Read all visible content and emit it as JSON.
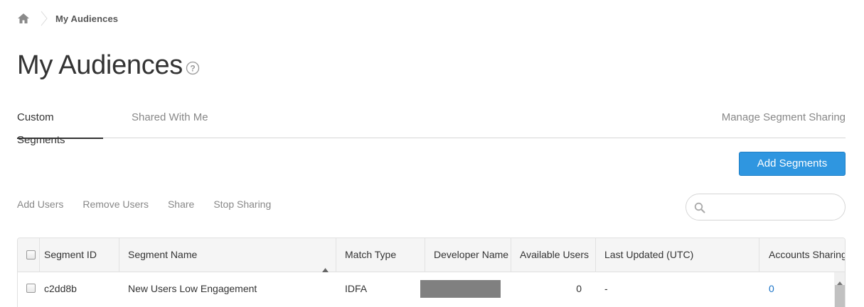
{
  "breadcrumb": {
    "home_icon": "home-icon",
    "current": "My Audiences"
  },
  "page": {
    "title": "My Audiences",
    "help_icon": "help-circle-icon"
  },
  "tabs": [
    {
      "label": "Custom Segments",
      "active": true
    },
    {
      "label": "Shared With Me",
      "active": false
    }
  ],
  "manage_link": "Manage Segment Sharing",
  "add_button": {
    "label": "Add Segments",
    "color": "#2f96e0"
  },
  "actions": [
    "Add Users",
    "Remove Users",
    "Share",
    "Stop Sharing"
  ],
  "search": {
    "placeholder": "",
    "value": "",
    "icon": "search-icon"
  },
  "table": {
    "columns": [
      "Segment ID",
      "Segment Name",
      "Match Type",
      "Developer Name",
      "Available Users",
      "Last Updated (UTC)",
      "Accounts Sharing"
    ],
    "sorted_column": "Segment Name",
    "sort_direction": "ascending",
    "rows": [
      {
        "segment_id": "c2dd8b",
        "segment_name": "New Users Low Engagement",
        "match_type": "IDFA",
        "developer_name": "",
        "available_users": "0",
        "last_updated": "-",
        "accounts_sharing": "0"
      }
    ]
  },
  "colors": {
    "link": "#1a73c7",
    "accent": "#2f96e0"
  }
}
